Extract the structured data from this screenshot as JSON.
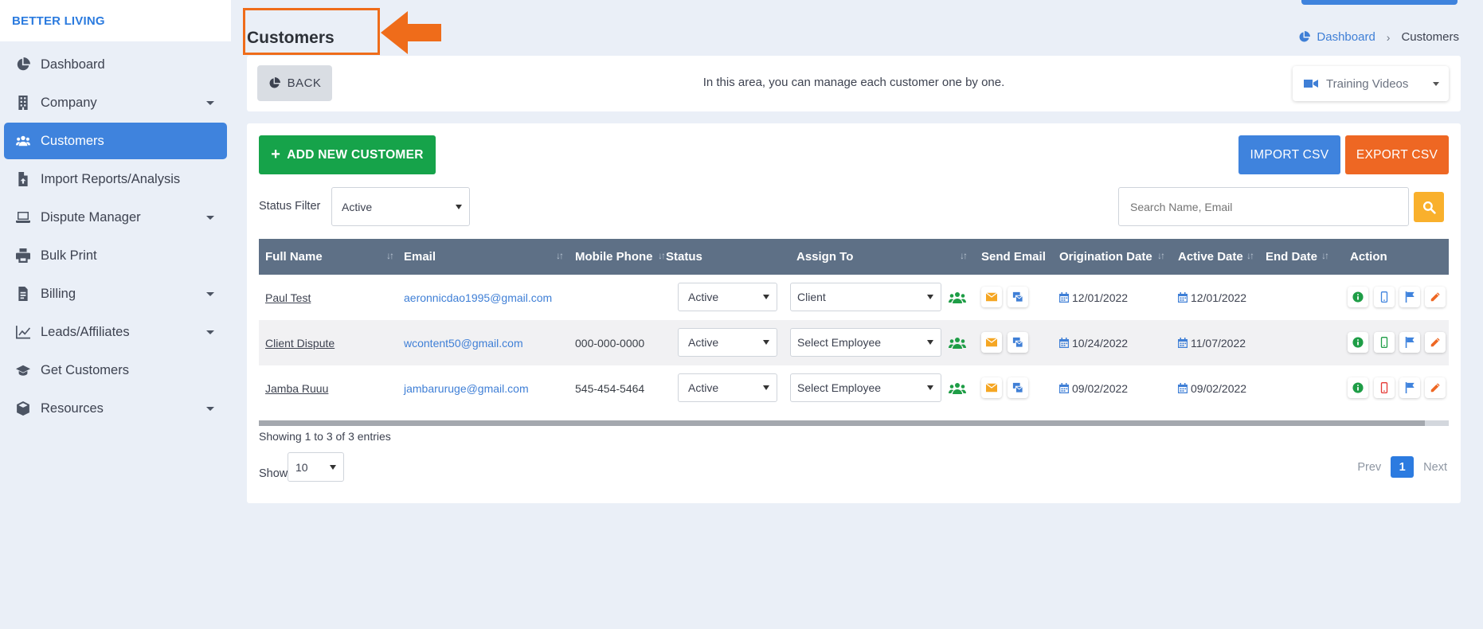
{
  "brand": "BETTER LIVING",
  "sidebar": {
    "items": [
      {
        "label": "Dashboard",
        "icon": "chart-pie-icon",
        "caret": false,
        "active": false
      },
      {
        "label": "Company",
        "icon": "building-icon",
        "caret": true,
        "active": false
      },
      {
        "label": "Customers",
        "icon": "users-icon",
        "caret": false,
        "active": true
      },
      {
        "label": "Import Reports/Analysis",
        "icon": "file-import-icon",
        "caret": false,
        "active": false
      },
      {
        "label": "Dispute Manager",
        "icon": "laptop-icon",
        "caret": true,
        "active": false
      },
      {
        "label": "Bulk Print",
        "icon": "printer-icon",
        "caret": false,
        "active": false
      },
      {
        "label": "Billing",
        "icon": "invoice-icon",
        "caret": true,
        "active": false
      },
      {
        "label": "Leads/Affiliates",
        "icon": "line-chart-icon",
        "caret": true,
        "active": false
      },
      {
        "label": "Get Customers",
        "icon": "graduation-cap-icon",
        "caret": false,
        "active": false
      },
      {
        "label": "Resources",
        "icon": "box-icon",
        "caret": true,
        "active": false
      }
    ]
  },
  "header": {
    "title": "Customers",
    "breadcrumb": {
      "home": "Dashboard",
      "current": "Customers"
    }
  },
  "info": {
    "back_label": "BACK",
    "message": "In this area, you can manage each customer one by one.",
    "training_label": "Training Videos"
  },
  "toolbar": {
    "add_label": "ADD NEW CUSTOMER",
    "import_label": "IMPORT CSV",
    "export_label": "EXPORT CSV",
    "status_filter_label": "Status Filter",
    "status_filter_value": "Active",
    "search_placeholder": "Search Name, Email"
  },
  "table": {
    "columns": {
      "full_name": "Full Name",
      "email": "Email",
      "mobile_phone": "Mobile Phone",
      "status": "Status",
      "assign_to": "Assign To",
      "send_email": "Send Email",
      "origination_date": "Origination Date",
      "active_date": "Active Date",
      "end_date": "End Date",
      "action": "Action"
    },
    "rows": [
      {
        "name": "Paul Test",
        "email": "aeronnicdao1995@gmail.com",
        "phone": "",
        "status": "Active",
        "assign": "Client",
        "origination": "12/01/2022",
        "active": "12/01/2022",
        "end": "",
        "phone_icon_color": "#3f83dd"
      },
      {
        "name": "Client Dispute",
        "email": "wcontent50@gmail.com",
        "phone": "000-000-0000",
        "status": "Active",
        "assign": "Select Employee",
        "origination": "10/24/2022",
        "active": "11/07/2022",
        "end": "",
        "phone_icon_color": "#1e9d46"
      },
      {
        "name": "Jamba Ruuu",
        "email": "jambaruruge@gmail.com",
        "phone": "545-454-5464",
        "status": "Active",
        "assign": "Select Employee",
        "origination": "09/02/2022",
        "active": "09/02/2022",
        "end": "",
        "phone_icon_color": "#e53935"
      }
    ]
  },
  "footer": {
    "showing": "Showing 1 to 3 of 3 entries",
    "show_label": "Show",
    "page_size": "10",
    "prev": "Prev",
    "page": "1",
    "next": "Next"
  },
  "colors": {
    "primary": "#3f83dd",
    "success": "#16a34a",
    "orange": "#ee6723",
    "warning": "#f9b02c",
    "table_header": "#5e7086",
    "annotation": "#ef6c1a"
  }
}
